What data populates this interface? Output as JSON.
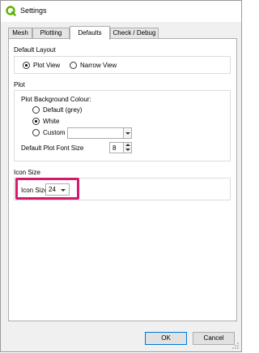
{
  "window": {
    "title": "Settings"
  },
  "tabs": [
    "Mesh",
    "Plotting",
    "Defaults",
    "Check / Debug"
  ],
  "active_tab": "Defaults",
  "default_layout": {
    "heading": "Default Layout",
    "options": [
      "Plot View",
      "Narrow View"
    ],
    "selected": "Plot View"
  },
  "plot": {
    "heading": "Plot",
    "bg_heading": "Plot Background Colour:",
    "bg_options": [
      "Default (grey)",
      "White",
      "Custom"
    ],
    "bg_selected": "White",
    "font_size_label": "Default Plot Font Size",
    "font_size_value": "8"
  },
  "icon_size": {
    "heading": "Icon Size",
    "label": "Icon Size",
    "value": "24"
  },
  "buttons": {
    "ok": "OK",
    "cancel": "Cancel"
  },
  "colors": {
    "highlight": "#d6186f",
    "qgis_green": "#5cb000"
  }
}
